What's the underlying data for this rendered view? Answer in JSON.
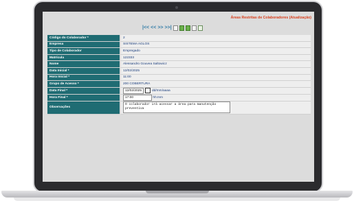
{
  "page_title": "Áreas Restritas de Colaboradores (Atualização)",
  "toolbar": {
    "first": "|<<",
    "prev": "<<",
    "next": ">>",
    "last": ">>|"
  },
  "form": {
    "codigo_label": "Código do Colaborador *",
    "codigo_value": "2",
    "empresa_label": "Empresa",
    "empresa_value": "SISTEMA AGLOS",
    "tipo_label": "Tipo de Colaborador",
    "tipo_value": "Empregado",
    "matricula_label": "Matrícula",
    "matricula_value": "122333",
    "nome_label": "Nome",
    "nome_value": "Alessandro Gouvea Saltowicz",
    "data_inicial_label": "Data Inicial *",
    "data_inicial_value": "12/02/2025",
    "hora_inicial_label": "Hora Inicial *",
    "hora_inicial_value": "11:00",
    "grupo_label": "Grupo de Acesso *",
    "grupo_value": "200 COBERTURA",
    "data_final_label": "Data Final *",
    "data_final_value": "12/02/2025",
    "data_final_hint": "dd/mm/aaaa",
    "hora_final_label": "Hora Final *",
    "hora_final_value": "17:00",
    "hora_final_hint": "hh:mm",
    "obs_label": "Observações",
    "obs_value": "O colaborador irá acessar a área para manutenção preventiva"
  },
  "icons": [
    "first-icon",
    "prev-icon",
    "next-icon",
    "last-icon",
    "new-icon",
    "save-icon",
    "edit-icon",
    "help-icon",
    "export-icon"
  ],
  "colors": {
    "label_bg": "#1f6c73",
    "title": "#d9411f",
    "value_text": "#1a3d7c"
  }
}
